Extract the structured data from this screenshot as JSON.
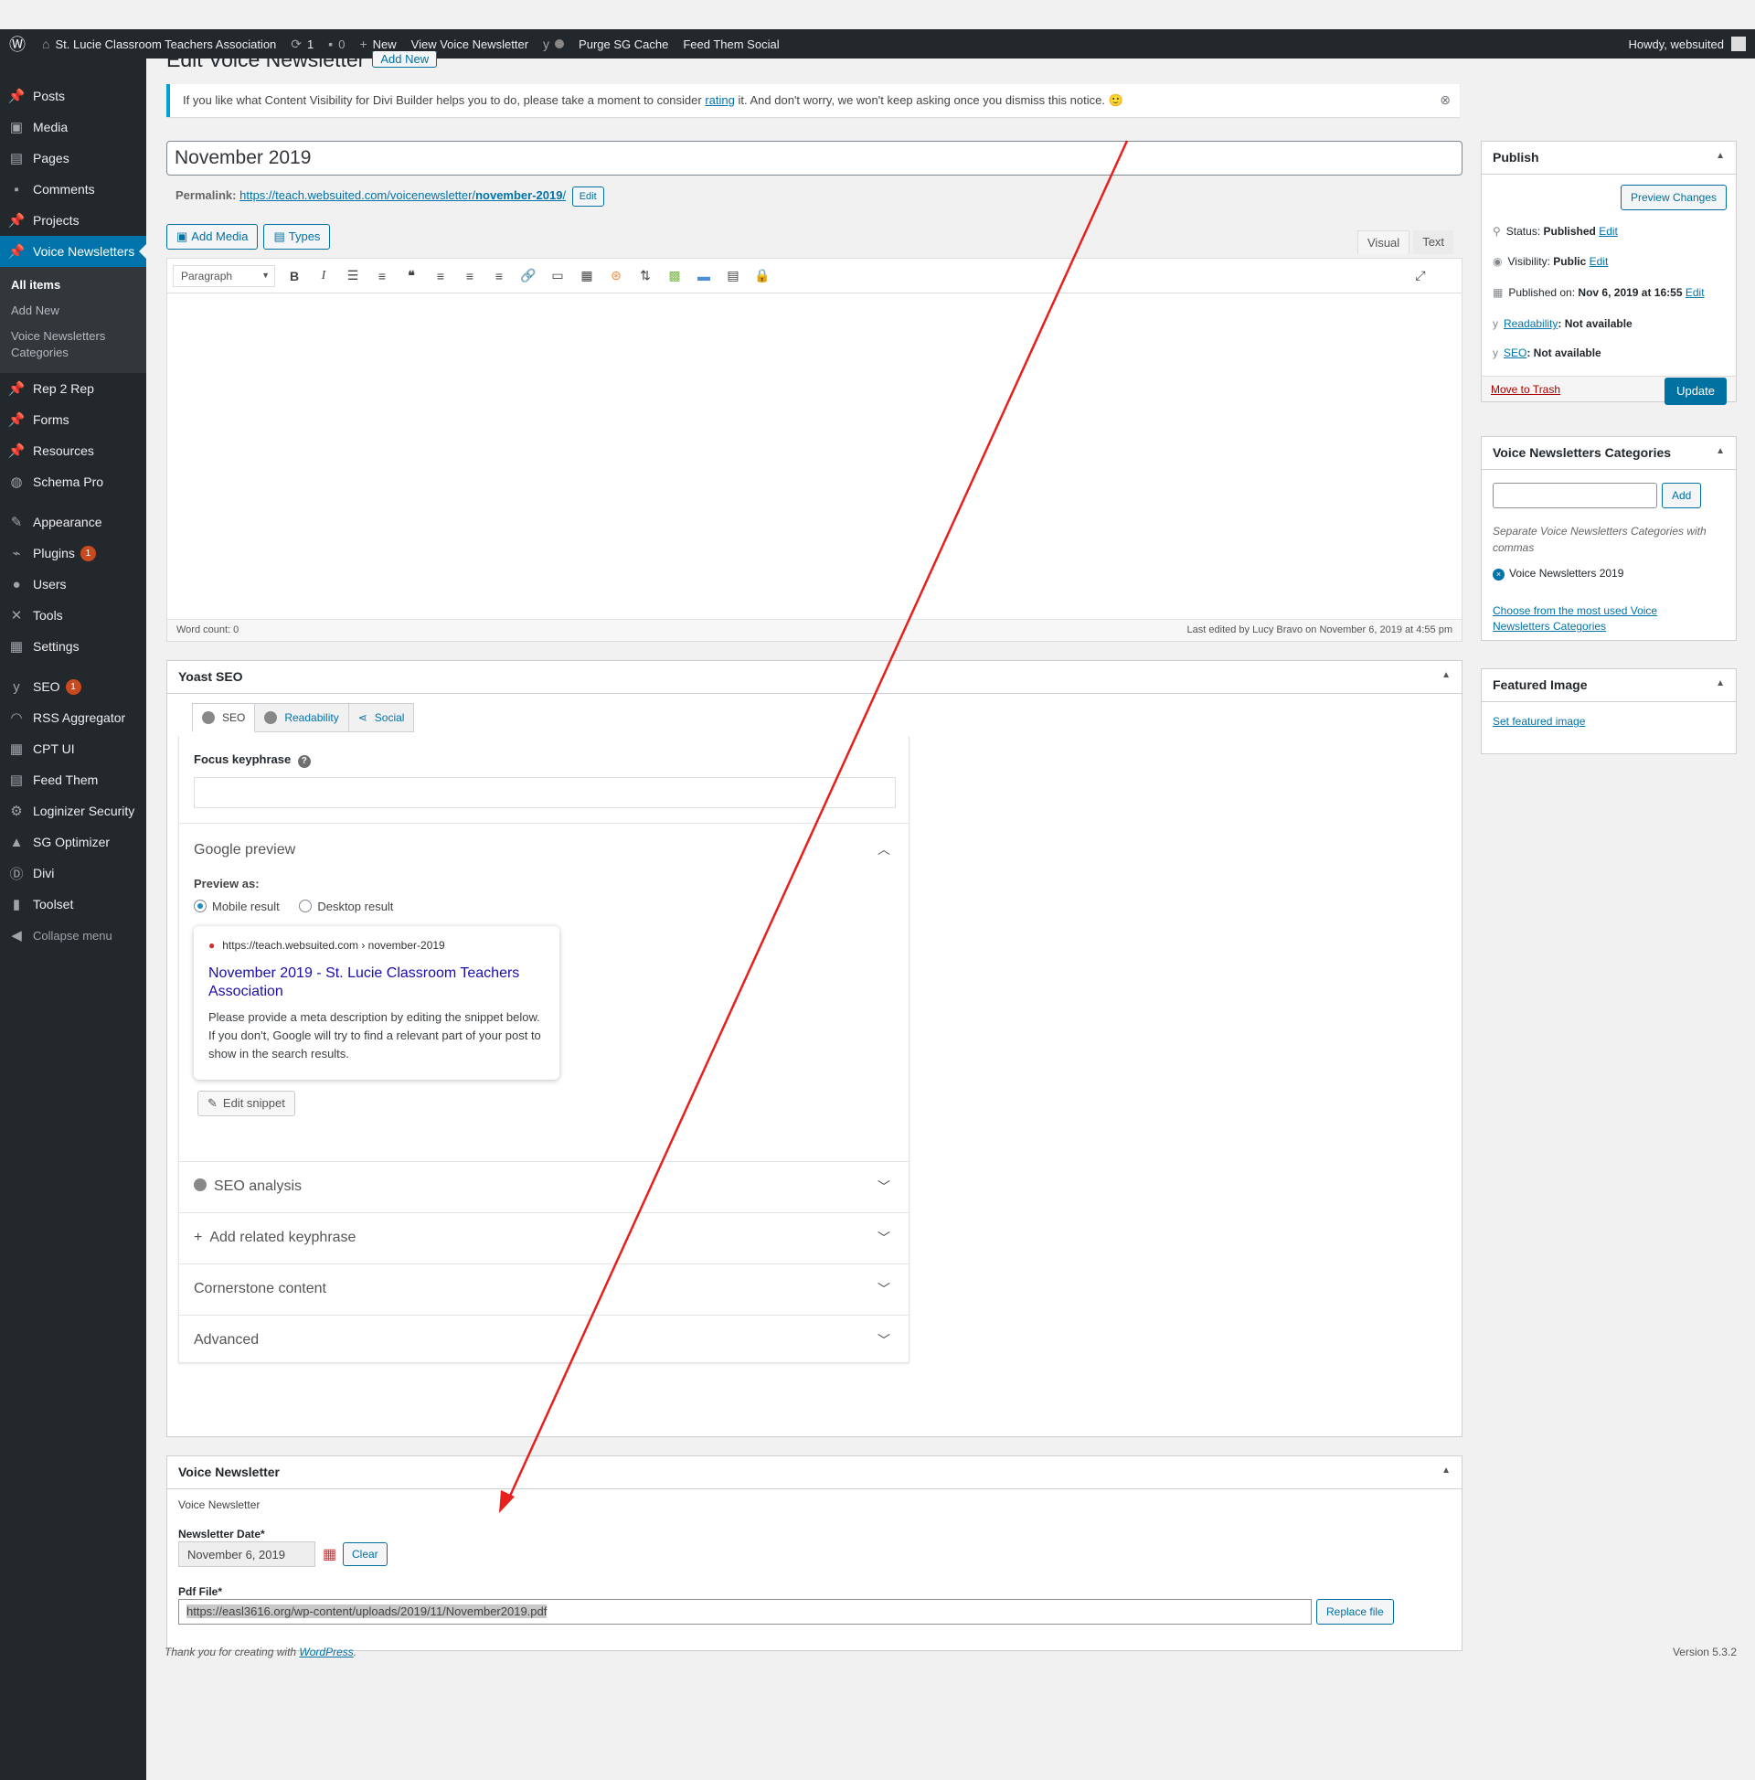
{
  "adminbar": {
    "site": "St. Lucie Classroom Teachers Association",
    "updates": "1",
    "comments": "0",
    "new": "New",
    "view": "View Voice Newsletter",
    "purge": "Purge SG Cache",
    "feed": "Feed Them Social",
    "howdy": "Howdy, websuited"
  },
  "sidebar": {
    "items": [
      {
        "label": "Posts",
        "icon": "pin-icon"
      },
      {
        "label": "Media",
        "icon": "media-icon"
      },
      {
        "label": "Pages",
        "icon": "pages-icon"
      },
      {
        "label": "Comments",
        "icon": "comments-icon"
      },
      {
        "label": "Projects",
        "icon": "pin-icon"
      },
      {
        "label": "Voice Newsletters",
        "icon": "pin-icon"
      }
    ],
    "sub": [
      "All items",
      "Add New",
      "Voice Newsletters Categories"
    ],
    "items2": [
      {
        "label": "Rep 2 Rep",
        "icon": "pin-icon"
      },
      {
        "label": "Forms",
        "icon": "pin-icon"
      },
      {
        "label": "Resources",
        "icon": "pin-icon"
      },
      {
        "label": "Schema Pro",
        "icon": "globe-icon"
      }
    ],
    "items3": [
      {
        "label": "Appearance",
        "icon": "brush-icon"
      },
      {
        "label": "Plugins",
        "icon": "plug-icon",
        "badge": "1"
      },
      {
        "label": "Users",
        "icon": "user-icon"
      },
      {
        "label": "Tools",
        "icon": "wrench-icon"
      },
      {
        "label": "Settings",
        "icon": "settings-icon"
      }
    ],
    "items4": [
      {
        "label": "SEO",
        "icon": "yoast-icon",
        "badge": "1"
      },
      {
        "label": "RSS Aggregator",
        "icon": "rss-icon"
      },
      {
        "label": "CPT UI",
        "icon": "grid-icon"
      },
      {
        "label": "Feed Them",
        "icon": "feed-icon"
      },
      {
        "label": "Loginizer Security",
        "icon": "gear-icon"
      },
      {
        "label": "SG Optimizer",
        "icon": "sg-icon"
      },
      {
        "label": "Divi",
        "icon": "divi-icon"
      },
      {
        "label": "Toolset",
        "icon": "toolset-icon"
      },
      {
        "label": "Collapse menu",
        "icon": "collapse-icon"
      }
    ]
  },
  "page": {
    "title": "Edit Voice Newsletter",
    "add_new": "Add New",
    "notice_pre": "If you like what Content Visibility for Divi Builder helps you to do, please take a moment to consider",
    "notice_link": "rating",
    "notice_post": "it. And don't worry, we won't keep asking once you dismiss this notice. 🙂",
    "post_title": "November 2019",
    "permalink_label": "Permalink:",
    "permalink_base": "https://teach.websuited.com/voicenewsletter/",
    "permalink_slug": "november-2019",
    "permalink_end": "/",
    "edit": "Edit",
    "add_media": "Add Media",
    "types": "Types",
    "tab_visual": "Visual",
    "tab_text": "Text",
    "paragraph": "Paragraph",
    "word_count": "Word count: 0",
    "last_edited": "Last edited by Lucy Bravo on November 6, 2019 at 4:55 pm"
  },
  "yoast": {
    "title": "Yoast SEO",
    "tabs": [
      "SEO",
      "Readability",
      "Social"
    ],
    "focus_label": "Focus keyphrase",
    "google_preview": "Google preview",
    "preview_as": "Preview as:",
    "mobile": "Mobile result",
    "desktop": "Desktop result",
    "snippet_url": "https://teach.websuited.com › november-2019",
    "snippet_title": "November 2019 - St. Lucie Classroom Teachers Association",
    "snippet_desc": "Please provide a meta description by editing the snippet below. If you don't, Google will try to find a relevant part of your post to show in the search results.",
    "edit_snippet": "Edit snippet",
    "seo_analysis": "SEO analysis",
    "related": "Add related keyphrase",
    "cornerstone": "Cornerstone content",
    "advanced": "Advanced"
  },
  "voice": {
    "title": "Voice Newsletter",
    "subtitle": "Voice Newsletter",
    "date_label": "Newsletter Date*",
    "date_value": "November 6, 2019",
    "clear": "Clear",
    "pdf_label": "Pdf File*",
    "pdf_value": "https://easl3616.org/wp-content/uploads/2019/11/November2019.pdf",
    "replace": "Replace file"
  },
  "publish": {
    "title": "Publish",
    "preview": "Preview Changes",
    "status_label": "Status:",
    "status_value": "Published",
    "visibility_label": "Visibility:",
    "visibility_value": "Public",
    "published_label": "Published on:",
    "published_value": "Nov 6, 2019 at 16:55",
    "readability_link": "Readability",
    "readability_value": ": Not available",
    "seo_link": "SEO",
    "seo_value": ": Not available",
    "trash": "Move to Trash",
    "update": "Update",
    "edit": "Edit"
  },
  "categories": {
    "title": "Voice Newsletters Categories",
    "add": "Add",
    "help": "Separate Voice Newsletters Categories with commas",
    "tag": "Voice Newsletters 2019",
    "choose": "Choose from the most used Voice Newsletters Categories"
  },
  "featured": {
    "title": "Featured Image",
    "link": "Set featured image"
  },
  "footer": {
    "thanks_pre": "Thank you for creating with",
    "thanks_link": "WordPress",
    "thanks_end": ".",
    "version": "Version 5.3.2"
  },
  "colors": {
    "accent": "#0073aa",
    "arrow": "#e5201e",
    "sidebar": "#23282d"
  }
}
